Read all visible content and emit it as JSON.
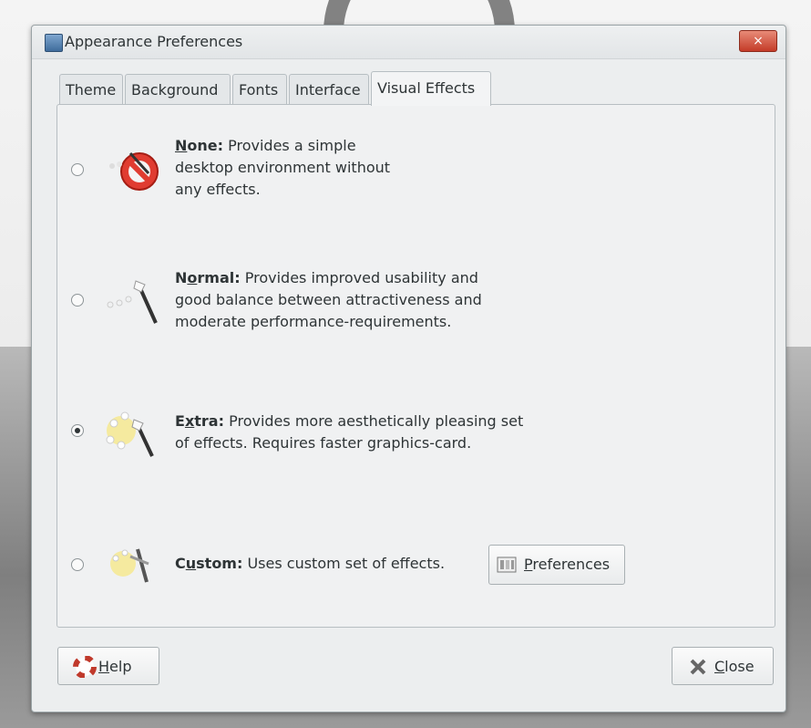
{
  "window": {
    "title": "Appearance Preferences",
    "close_glyph": "×"
  },
  "tabs": [
    {
      "label": "Theme"
    },
    {
      "label": "Background"
    },
    {
      "label": "Fonts"
    },
    {
      "label": "Interface"
    },
    {
      "label": "Visual Effects"
    }
  ],
  "active_tab": "Visual Effects",
  "options": [
    {
      "name_first": "N",
      "name_rest": "one:",
      "description": "Provides a simple desktop environment without any effects.",
      "line1": "Provides a simple",
      "line2": "desktop environment without",
      "line3": "any effects.",
      "selected": false,
      "icon": "no-effects-icon"
    },
    {
      "name_first": "N",
      "name_underline": "o",
      "name_rest": "rmal:",
      "line1": "Provides improved usability and",
      "line2": "good balance between attractiveness and",
      "line3": "moderate performance-requirements.",
      "selected": false,
      "icon": "magic-wand-icon"
    },
    {
      "name_first": "E",
      "name_underline": "x",
      "name_rest": "tra:",
      "line1": "Provides more aesthetically pleasing set",
      "line2": "of effects. Requires faster graphics-card.",
      "selected": true,
      "icon": "magic-wand-sparkles-icon"
    },
    {
      "name_first": "C",
      "name_underline": "u",
      "name_rest": "stom:",
      "line1": "Uses custom set of effects.",
      "selected": false,
      "icon": "custom-wand-icon"
    }
  ],
  "preferences_button": {
    "underline": "P",
    "rest": "references",
    "icon": "preferences-icon"
  },
  "help_button": {
    "underline": "H",
    "rest": "elp",
    "icon": "help-lifebuoy-icon"
  },
  "close_button": {
    "underline": "C",
    "rest": "lose",
    "icon": "close-x-icon"
  },
  "colors": {
    "radio_dot": "#2e3436",
    "close_red": "#c43b28"
  }
}
